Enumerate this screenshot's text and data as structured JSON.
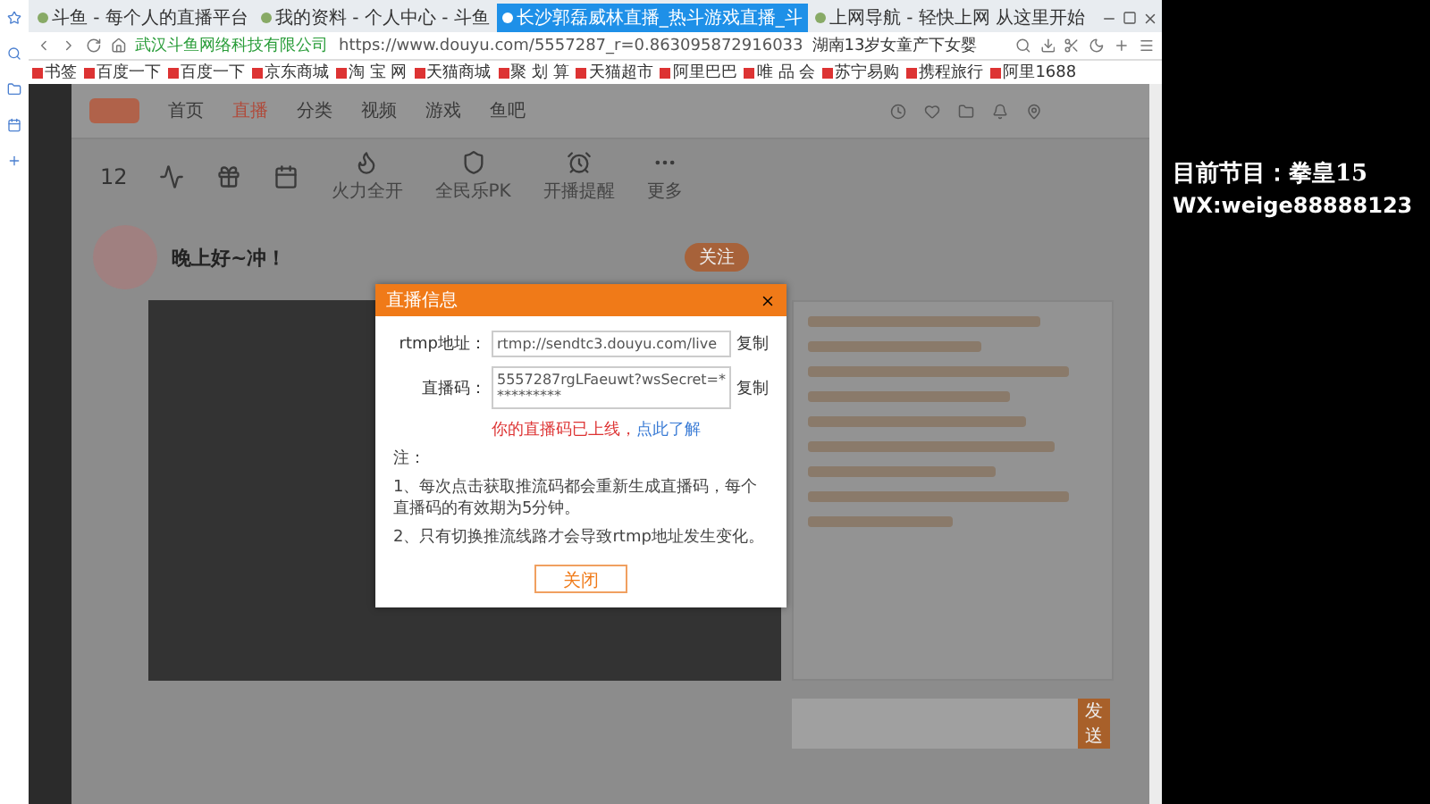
{
  "browser": {
    "tabs": [
      {
        "label": "斗鱼 - 每个人的直播平台",
        "selected": false
      },
      {
        "label": "我的资料 - 个人中心 - 斗鱼",
        "selected": false
      },
      {
        "label": "长沙郭磊威林直播_热斗游戏直播_斗",
        "selected": true
      },
      {
        "label": "上网导航 - 轻快上网 从这里开始",
        "selected": false
      }
    ],
    "site_name": "武汉斗鱼网络科技有限公司",
    "url": "https://www.douyu.com/5557287_r=0.863095872916033",
    "search_text": "湖南13岁女童产下女婴",
    "bookmarks": [
      "书签",
      "百度一下",
      "百度一下",
      "京东商城",
      "淘 宝 网",
      "天猫商城",
      "聚 划 算",
      "天猫超市",
      "阿里巴巴",
      "唯 品 会",
      "苏宁易购",
      "携程旅行",
      "阿里1688"
    ]
  },
  "page": {
    "nav": [
      {
        "label": "首页",
        "selected": false
      },
      {
        "label": "直播",
        "selected": true
      },
      {
        "label": "分类",
        "selected": false
      },
      {
        "label": "视频",
        "selected": false
      },
      {
        "label": "游戏",
        "selected": false
      },
      {
        "label": "鱼吧",
        "selected": false
      }
    ],
    "score": "12",
    "tools": [
      "火力全开",
      "全民乐PK",
      "开播提醒",
      "更多"
    ],
    "room_title": "晚上好~冲！",
    "follow_button": "关注",
    "send_button": "发送"
  },
  "dialog": {
    "title": "直播信息",
    "rtmp_label": "rtmp地址：",
    "rtmp_value": "rtmp://sendtc3.douyu.com/live",
    "code_label": "直播码：",
    "code_value": "5557287rgLFaeuwt?wsSecret=**********",
    "copy_buttons": [
      "复制",
      "复制"
    ],
    "warning": "你的直播码已上线，",
    "warning_link": "点此了解",
    "notes": [
      "注：",
      "1、每次点击获取推流码都会重新生成直播码，每个直播码的有效期为5分钟。",
      "2、只有切换推流线路才会导致rtmp地址发生变化。"
    ],
    "close_button": "关闭"
  },
  "stream_overlay": {
    "program": "目前节目：拳皇15",
    "contact": "WX:weige88888123"
  }
}
